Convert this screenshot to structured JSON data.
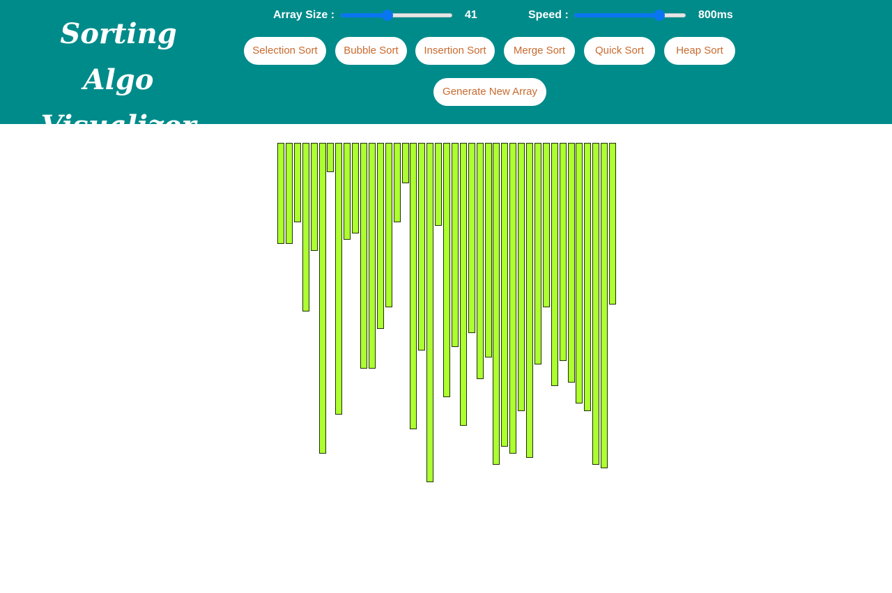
{
  "header": {
    "title_line1": "Sorting Algo",
    "title_line2": "Visualizer",
    "array_size_label": "Array Size :",
    "array_size_value": "41",
    "array_size_slider_fraction": 0.42,
    "speed_label": "Speed :",
    "speed_value": "800ms",
    "speed_slider_fraction": 0.76
  },
  "buttons": {
    "selection": "Selection Sort",
    "bubble": "Bubble Sort",
    "insertion": "Insertion Sort",
    "merge": "Merge Sort",
    "quick": "Quick Sort",
    "heap": "Heap Sort",
    "generate": "Generate New Array"
  },
  "colors": {
    "header": "#008b8b",
    "bar": "#adff2f",
    "button_text": "#c86a2e",
    "slider": "#0a75f0"
  },
  "array": [
    145,
    145,
    114,
    242,
    155,
    446,
    42,
    390,
    139,
    130,
    324,
    324,
    267,
    236,
    114,
    58,
    411,
    298,
    487,
    119,
    365,
    293,
    406,
    273,
    339,
    308,
    462,
    436,
    446,
    385,
    452,
    318,
    236,
    349,
    313,
    344,
    374,
    385,
    462,
    467,
    232
  ]
}
